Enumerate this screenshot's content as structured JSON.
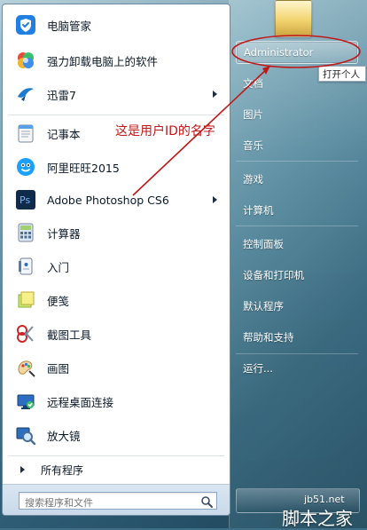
{
  "left_menu": {
    "items": [
      {
        "label": "电脑管家",
        "icon": "shield-check-icon",
        "has_arrow": false
      },
      {
        "label": "强力卸载电脑上的软件",
        "icon": "clover-icon",
        "has_arrow": false
      },
      {
        "label": "迅雷7",
        "icon": "thunder-bird-icon",
        "has_arrow": true
      },
      {
        "label": "记事本",
        "icon": "notepad-icon",
        "has_arrow": false
      },
      {
        "label": "阿里旺旺2015",
        "icon": "ali-wangwang-icon",
        "has_arrow": false
      },
      {
        "label": "Adobe Photoshop CS6",
        "icon": "photoshop-icon",
        "has_arrow": true
      },
      {
        "label": "计算器",
        "icon": "calculator-icon",
        "has_arrow": false
      },
      {
        "label": "入门",
        "icon": "getting-started-icon",
        "has_arrow": false
      },
      {
        "label": "便笺",
        "icon": "sticky-notes-icon",
        "has_arrow": false
      },
      {
        "label": "截图工具",
        "icon": "snipping-tool-icon",
        "has_arrow": false
      },
      {
        "label": "画图",
        "icon": "paint-icon",
        "has_arrow": false
      },
      {
        "label": "远程桌面连接",
        "icon": "remote-desktop-icon",
        "has_arrow": false
      },
      {
        "label": "放大镜",
        "icon": "magnifier-icon",
        "has_arrow": false
      }
    ],
    "all_programs_label": "所有程序",
    "search_placeholder": "搜索程序和文件"
  },
  "right_menu": {
    "items": [
      {
        "label": "Administrator"
      },
      {
        "label": "文档"
      },
      {
        "label": "图片"
      },
      {
        "label": "音乐"
      },
      {
        "label": "游戏"
      },
      {
        "label": "计算机"
      },
      {
        "label": "控制面板"
      },
      {
        "label": "设备和打印机"
      },
      {
        "label": "默认程序"
      },
      {
        "label": "帮助和支持"
      },
      {
        "label": "运行..."
      }
    ],
    "tooltip": "打开个人"
  },
  "annotation": {
    "text": "这是用户ID的名字",
    "color": "#c01818"
  },
  "watermark": {
    "url": "jb51.net",
    "label": "脚本之家"
  }
}
